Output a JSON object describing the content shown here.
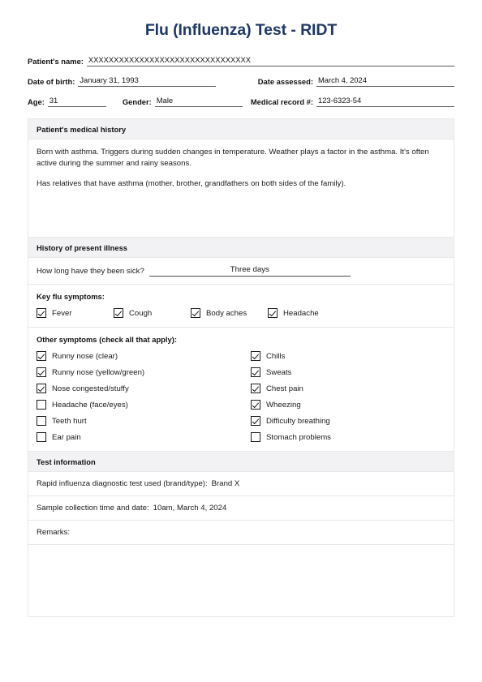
{
  "document": {
    "title": "Flu (Influenza) Test - RIDT",
    "title_color": "#1f3864"
  },
  "header": {
    "fields": {
      "patient_name_label": "Patient's name:",
      "patient_name_value": "XXXXXXXXXXXXXXXXXXXXXXXXXXXXXXXX",
      "dob_label": "Date of birth:",
      "dob_value": "January 31, 1993",
      "date_assessed_label": "Date assessed:",
      "date_assessed_value": "March 4, 2024",
      "age_label": "Age:",
      "age_value": "31",
      "gender_label": "Gender:",
      "gender_value": "Male",
      "mrn_label": "Medical record #:",
      "mrn_value": "123-6323-54"
    }
  },
  "medical_history": {
    "heading": "Patient's medical history",
    "paragraph_1": "Born with asthma. Triggers during sudden changes in temperature. Weather plays a factor in the asthma. It's often active during the summer and rainy seasons.",
    "paragraph_2": "Has relatives that have asthma (mother, brother, grandfathers on both sides of the family)."
  },
  "present_illness": {
    "heading": "History of present illness",
    "duration_question": "How long have they been sick?",
    "duration_answer": "Three days"
  },
  "key_symptoms": {
    "title": "Key flu symptoms:",
    "items": [
      {
        "label": "Fever",
        "checked": true
      },
      {
        "label": "Cough",
        "checked": true
      },
      {
        "label": "Body aches",
        "checked": true
      },
      {
        "label": "Headache",
        "checked": true
      }
    ]
  },
  "other_symptoms": {
    "title": "Other symptoms (check all that apply):",
    "left_column": [
      {
        "label": "Runny nose (clear)",
        "checked": true
      },
      {
        "label": "Runny nose (yellow/green)",
        "checked": true
      },
      {
        "label": "Nose congested/stuffy",
        "checked": true
      },
      {
        "label": "Headache (face/eyes)",
        "checked": false
      },
      {
        "label": "Teeth hurt",
        "checked": false
      },
      {
        "label": "Ear pain",
        "checked": false
      }
    ],
    "right_column": [
      {
        "label": "Chills",
        "checked": true
      },
      {
        "label": "Sweats",
        "checked": true
      },
      {
        "label": "Chest pain",
        "checked": true
      },
      {
        "label": "Wheezing",
        "checked": true
      },
      {
        "label": "Difficulty breathing",
        "checked": true
      },
      {
        "label": "Stomach problems",
        "checked": false
      }
    ]
  },
  "test_information": {
    "heading": "Test information",
    "brand_label": "Rapid influenza diagnostic test used (brand/type):",
    "brand_value": "Brand X",
    "sample_label": "Sample collection time and date:",
    "sample_value": "10am, March 4, 2024",
    "remarks_label": "Remarks:",
    "remarks_value": ""
  }
}
